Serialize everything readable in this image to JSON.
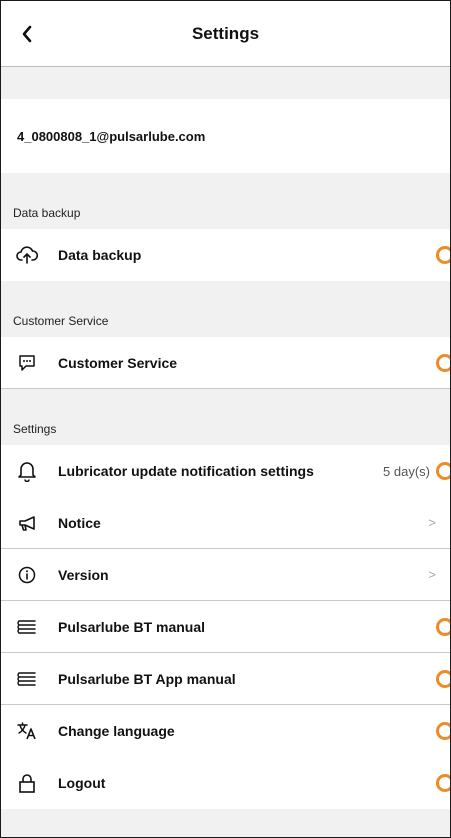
{
  "header": {
    "title": "Settings"
  },
  "account": {
    "email": "4_0800808_1@pulsarlube.com"
  },
  "sections": {
    "data_backup": {
      "label": "Data backup",
      "items": [
        {
          "label": "Data backup",
          "icon": "cloud-upload-icon"
        }
      ]
    },
    "customer_service": {
      "label": "Customer Service",
      "items": [
        {
          "label": "Customer Service",
          "icon": "chat-icon"
        }
      ]
    },
    "settings": {
      "label": "Settings",
      "items": [
        {
          "label": "Lubricator update notification settings",
          "icon": "bell-icon",
          "value": "5 day(s)"
        },
        {
          "label": "Notice",
          "icon": "megaphone-icon",
          "chevron": ">"
        },
        {
          "label": "Version",
          "icon": "info-icon",
          "chevron": ">"
        },
        {
          "label": "Pulsarlube BT manual",
          "icon": "book-icon"
        },
        {
          "label": "Pulsarlube BT App manual",
          "icon": "book-icon"
        },
        {
          "label": "Change language",
          "icon": "translate-icon"
        },
        {
          "label": "Logout",
          "icon": "lock-icon"
        }
      ]
    }
  },
  "colors": {
    "accent": "#f08a24",
    "background": "#f1f1f1",
    "divider": "#c9c9c9"
  }
}
